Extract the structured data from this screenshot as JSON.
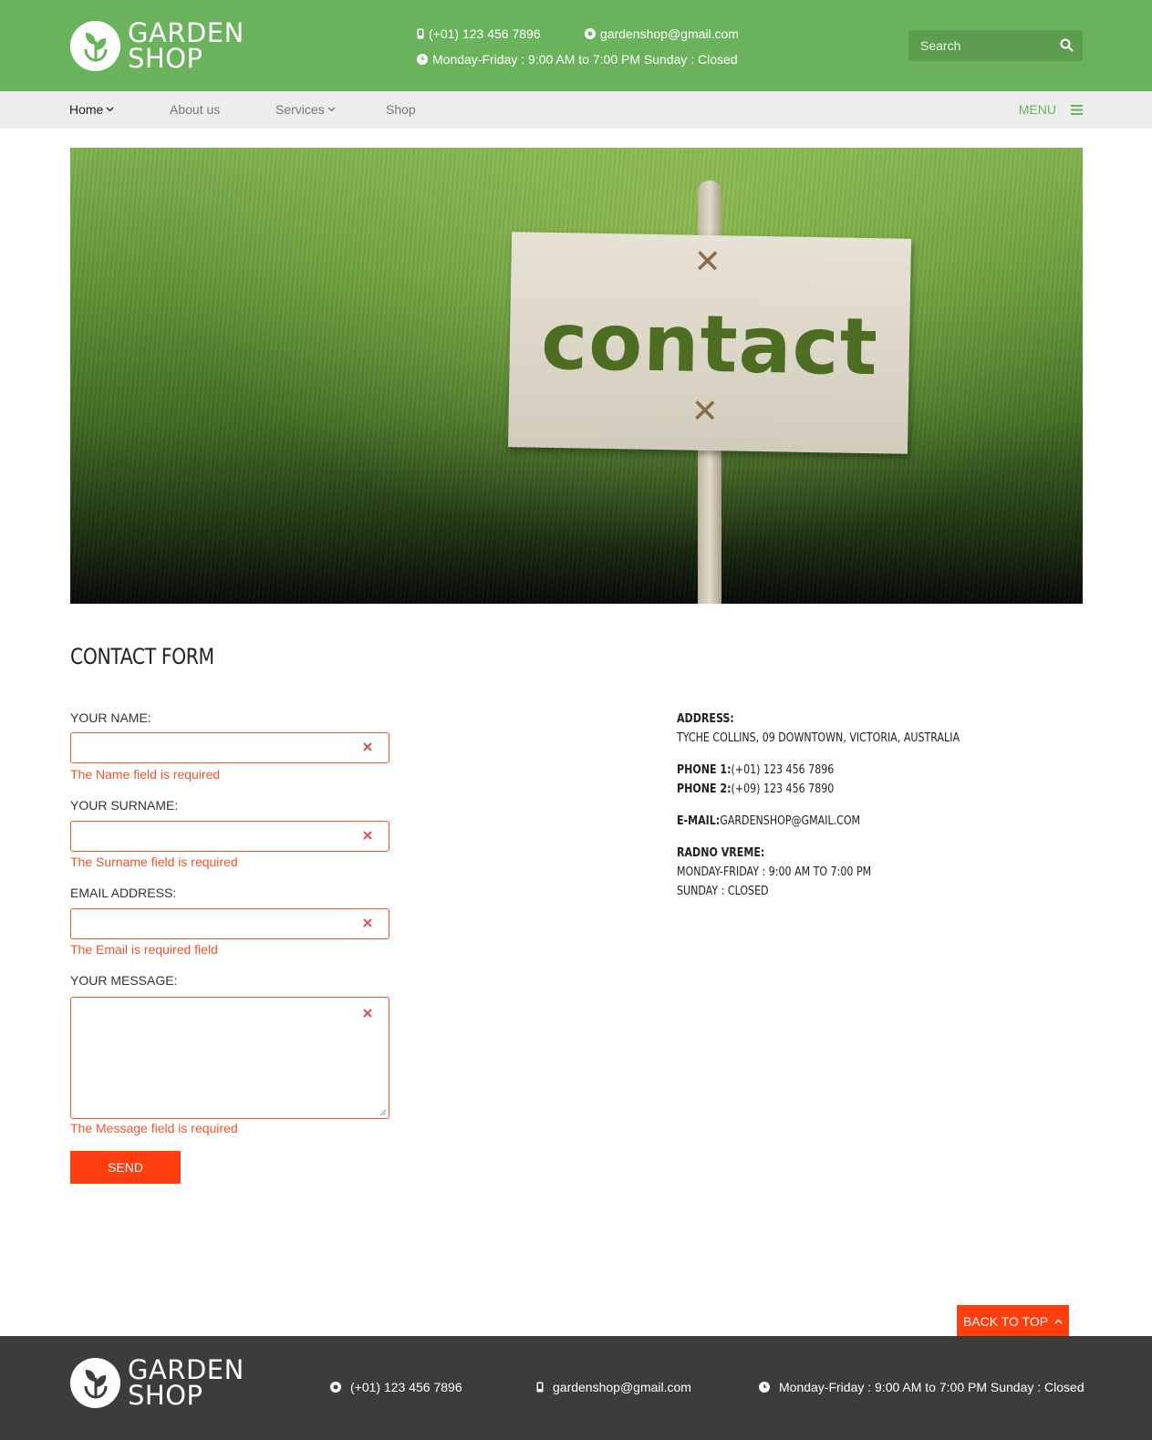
{
  "header": {
    "logo_line1": "GARDEN",
    "logo_line2": "SHOP",
    "phone": "(+01) 123 456 7896",
    "email": "gardenshop@gmail.com",
    "hours": "Monday-Friday : 9:00 AM to 7:00 PM Sunday : Closed",
    "search_placeholder": "Search"
  },
  "nav": {
    "items": [
      {
        "label": "Home"
      },
      {
        "label": "About us"
      },
      {
        "label": "Services"
      },
      {
        "label": "Shop"
      }
    ],
    "menu_label": "MENU"
  },
  "hero": {
    "sign_text": "contact"
  },
  "form": {
    "title": "CONTACT FORM",
    "name_label": "YOUR NAME:",
    "name_error": "The Name field is required",
    "surname_label": "YOUR SURNAME:",
    "surname_error": "The Surname field is required",
    "email_label": "EMAIL ADDRESS:",
    "email_error": "The Email is required field",
    "message_label": "YOUR MESSAGE:",
    "message_error": "The Message field is required",
    "send_label": "SEND"
  },
  "info": {
    "address_label": "ADDRESS:",
    "address_value": "TYCHE COLLINS, 09 DOWNTOWN, VICTORIA, AUSTRALIA",
    "phone1_label": "PHONE 1:",
    "phone1_value": "(+01) 123 456 7896",
    "phone2_label": "PHONE 2:",
    "phone2_value": "(+09) 123 456 7890",
    "email_label": "E-MAIL:",
    "email_value": "GARDENSHOP@GMAIL.COM",
    "hours_label": "RADNO VREME:",
    "hours_line1": "MONDAY-FRIDAY : 9:00 AM TO 7:00 PM",
    "hours_line2": "SUNDAY : CLOSED"
  },
  "back_to_top": "BACK TO TOP",
  "footer": {
    "logo_line1": "GARDEN",
    "logo_line2": "SHOP",
    "phone": "(+01) 123 456 7896",
    "email": "gardenshop@gmail.com",
    "hours": "Monday-Friday : 9:00 AM to 7:00 PM Sunday : Closed"
  },
  "colors": {
    "brand_green": "#6ab35c",
    "accent_red": "#ff3d0e",
    "footer_bg": "#3c3c3c",
    "nav_bg": "#ededed"
  },
  "icons": [
    "leaf-logo-icon",
    "phone-icon",
    "email-icon",
    "clock-icon",
    "search-icon",
    "chevron-down-icon",
    "hamburger-icon",
    "close-icon",
    "chevron-up-icon"
  ]
}
